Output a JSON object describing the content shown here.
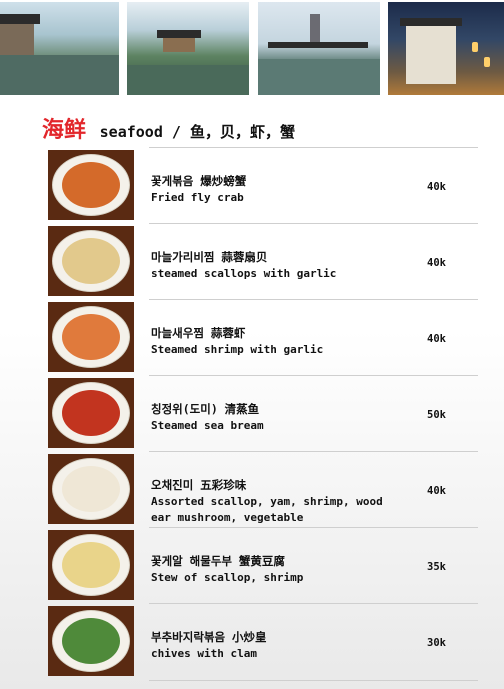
{
  "colors": {
    "accent": "#e2262b"
  },
  "banner": {
    "photos": [
      {
        "icon": "canal-town-photo"
      },
      {
        "icon": "pavilion-lake-photo"
      },
      {
        "icon": "pagoda-canal-photo"
      },
      {
        "icon": "night-street-photo"
      }
    ]
  },
  "section": {
    "title_cn": "海鲜",
    "title_en": "seafood / 鱼，贝，虾，蟹"
  },
  "items": [
    {
      "name": "꽃게볶음 爆炒螃蟹",
      "desc": "Fried fly crab",
      "price": "40k",
      "food_color": "#d46a2a"
    },
    {
      "name": "마늘가리비찜 蒜蓉扇贝",
      "desc": "steamed scallops with garlic",
      "price": "40k",
      "food_color": "#e2c98c"
    },
    {
      "name": "마늘새우찜 蒜蓉虾",
      "desc": "Steamed shrimp with garlic",
      "price": "40k",
      "food_color": "#e07a3c"
    },
    {
      "name": "칭정위(도미) 清蒸鱼",
      "desc": "Steamed sea bream",
      "price": "50k",
      "food_color": "#c2341f"
    },
    {
      "name": "오채진미 五彩珍味",
      "desc": "Assorted scallop, yam, shrimp, wood ear mushroom, vegetable",
      "price": "40k",
      "food_color": "#efe7d6"
    },
    {
      "name": "꽃게알 해물두부 蟹黄豆腐",
      "desc": "Stew of scallop, shrimp",
      "price": "35k",
      "food_color": "#e9d48a"
    },
    {
      "name": "부추바지락볶음 小炒皇",
      "desc": "chives with clam",
      "price": "30k",
      "food_color": "#4f8a3a"
    }
  ]
}
